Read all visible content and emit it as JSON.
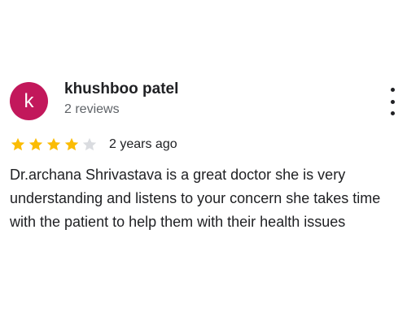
{
  "review": {
    "reviewer": {
      "initial": "k",
      "name": "khushboo patel",
      "meta": "2 reviews",
      "avatar_color": "#c2185b"
    },
    "more_menu_icon": "more-vertical-icon",
    "rating": {
      "stars_filled": 4,
      "stars_total": 5,
      "filled_color": "#fbbc04",
      "empty_color": "#dadce0"
    },
    "age": "2 years ago",
    "text": "Dr.archana Shrivastava is a great doctor she is very understanding and listens to your concern she takes time with the patient to help them with their health issues"
  }
}
